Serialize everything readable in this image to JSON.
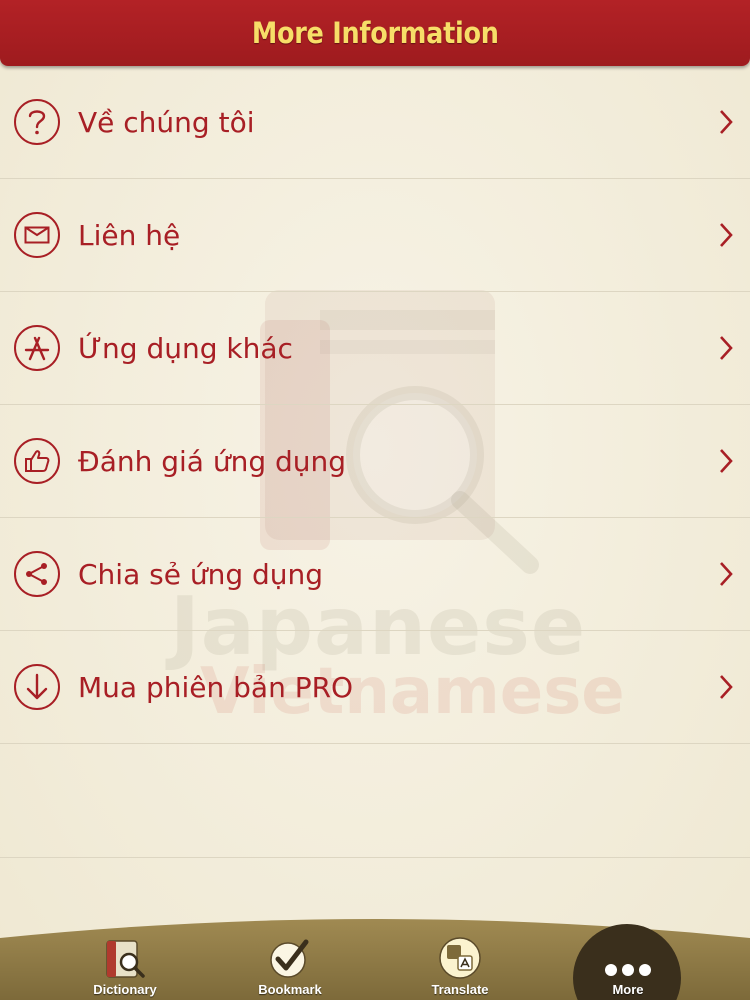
{
  "header": {
    "title": "More Information"
  },
  "watermark": {
    "line1": "Japanese",
    "line2": "Vietnamese"
  },
  "menu": {
    "items": [
      {
        "label": "Về chúng tôi",
        "icon": "question-icon"
      },
      {
        "label": "Liên hệ",
        "icon": "mail-icon"
      },
      {
        "label": "Ứng dụng khác",
        "icon": "app-store-icon"
      },
      {
        "label": "Đánh giá ứng dụng",
        "icon": "thumbs-up-icon"
      },
      {
        "label": "Chia sẻ ứng dụng",
        "icon": "share-icon"
      },
      {
        "label": "Mua phiên bản PRO",
        "icon": "download-icon"
      }
    ]
  },
  "tabs": {
    "dictionary": "Dictionary",
    "bookmark": "Bookmark",
    "translate": "Translate",
    "more": "More"
  },
  "colors": {
    "accent": "#a81f25",
    "header": "#b32226",
    "title": "#f7de68",
    "tabbar": "#8a7845"
  }
}
